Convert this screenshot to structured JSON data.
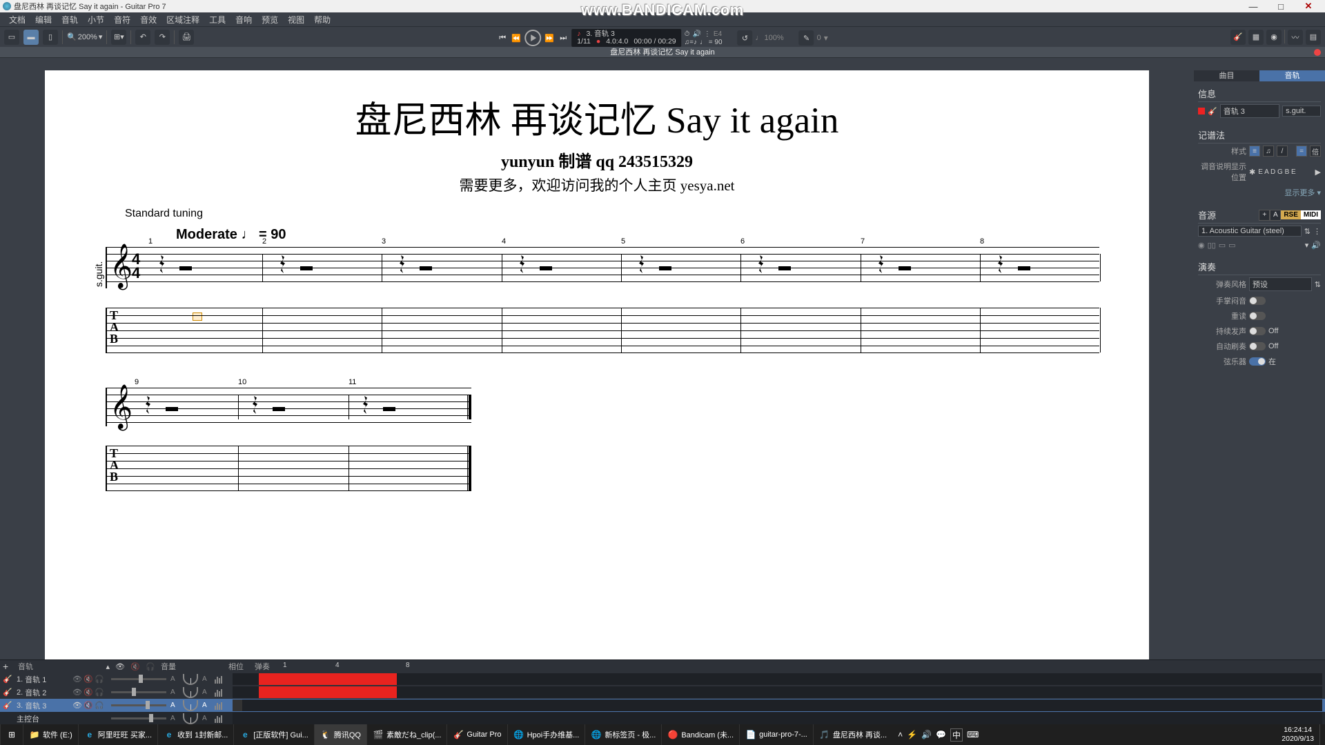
{
  "title": "盘尼西林 再谈记忆 Say it again - Guitar Pro 7",
  "watermark": "www.BANDICAM.com",
  "menu": [
    "文档",
    "编辑",
    "音轨",
    "小节",
    "音符",
    "音效",
    "区域注释",
    "工具",
    "音响",
    "预览",
    "视图",
    "帮助"
  ],
  "zoom": "200%",
  "transport": {
    "track_label": "3. 音轨 3",
    "bar": "1/11",
    "timesig": "4.0:4.0",
    "time": "00:00 / 00:29",
    "tempo": "♩ = 90",
    "speed": "100%",
    "capo": "0",
    "chordE": "E4"
  },
  "tab_title": "盘尼西林 再谈记忆 Say it again",
  "score": {
    "title": "盘尼西林 再谈记忆 Say it again",
    "subtitle": "yunyun 制谱 qq 243515329",
    "note": "需要更多，欢迎访问我的个人主页 yesya.net",
    "tuning": "Standard tuning",
    "tempo": "Moderate ♩ = 90",
    "instrument": "s.guit.",
    "tab_letters": "T\nA\nB",
    "timesig_top": "4",
    "timesig_bot": "4",
    "row1_measures": [
      1,
      2,
      3,
      4,
      5,
      6,
      7,
      8
    ],
    "row2_measures": [
      9,
      10,
      11
    ]
  },
  "side": {
    "tab_song": "曲目",
    "tab_track": "音轨",
    "h_info": "信息",
    "track_name": "音轨 3",
    "track_short": "s.guit.",
    "h_notation": "记谱法",
    "lbl_style": "样式",
    "lbl_tuning_pos": "调音说明显示位置",
    "tuning_val": "E A D G B E",
    "show_more": "显示更多 ▾",
    "h_sound": "音源",
    "sound_name": "1. Acoustic Guitar (steel)",
    "rse": "RSE",
    "midi": "MIDI",
    "plus": "+",
    "a_btn": "A",
    "h_play": "演奏",
    "lbl_strum": "弹奏风格",
    "strum_val": "预设",
    "lbl_palm": "手掌闷音",
    "lbl_repeat": "重读",
    "lbl_sustain": "持续发声",
    "lbl_autobrush": "自动刷奏",
    "lbl_strings": "弦乐器",
    "off": "Off",
    "on": "在",
    "hu": "倍"
  },
  "tracks": {
    "hdr_track": "音轨",
    "hdr_vol": "音量",
    "hdr_pan": "相位",
    "hdr_view": "弹奏",
    "ruler": {
      "m1": "1",
      "m4": "4",
      "m8": "8"
    },
    "rows": [
      {
        "n": "1.",
        "name": "音轨 1"
      },
      {
        "n": "2.",
        "name": "音轨 2"
      },
      {
        "n": "3.",
        "name": "音轨 3"
      }
    ],
    "master": "主控台"
  },
  "taskbar": {
    "items": [
      {
        "icon": "📁",
        "label": "软件 (E:)"
      },
      {
        "icon": "e",
        "label": "阿里旺旺 买家..."
      },
      {
        "icon": "e",
        "label": "收到 1封新邮..."
      },
      {
        "icon": "e",
        "label": "[正版软件] Gui..."
      },
      {
        "icon": "🐧",
        "label": "腾讯QQ"
      },
      {
        "icon": "🎬",
        "label": "素敵だね_clip(..."
      },
      {
        "icon": "🎸",
        "label": "Guitar Pro"
      },
      {
        "icon": "🌐",
        "label": "Hpoi手办维基..."
      },
      {
        "icon": "🌐",
        "label": "新标签页 - 极..."
      },
      {
        "icon": "🔴",
        "label": "Bandicam (未..."
      },
      {
        "icon": "📄",
        "label": "guitar-pro-7-..."
      },
      {
        "icon": "🎵",
        "label": "盘尼西林 再谈..."
      }
    ],
    "ime": "中",
    "time": "16:24:14",
    "date": "2020/9/13"
  }
}
